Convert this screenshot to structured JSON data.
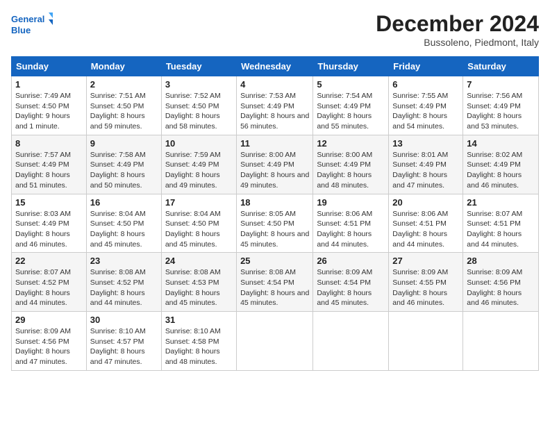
{
  "header": {
    "logo_line1": "General",
    "logo_line2": "Blue",
    "month_title": "December 2024",
    "location": "Bussoleno, Piedmont, Italy"
  },
  "days_of_week": [
    "Sunday",
    "Monday",
    "Tuesday",
    "Wednesday",
    "Thursday",
    "Friday",
    "Saturday"
  ],
  "weeks": [
    [
      {
        "day": 1,
        "info": "Sunrise: 7:49 AM\nSunset: 4:50 PM\nDaylight: 9 hours and 1 minute."
      },
      {
        "day": 2,
        "info": "Sunrise: 7:51 AM\nSunset: 4:50 PM\nDaylight: 8 hours and 59 minutes."
      },
      {
        "day": 3,
        "info": "Sunrise: 7:52 AM\nSunset: 4:50 PM\nDaylight: 8 hours and 58 minutes."
      },
      {
        "day": 4,
        "info": "Sunrise: 7:53 AM\nSunset: 4:49 PM\nDaylight: 8 hours and 56 minutes."
      },
      {
        "day": 5,
        "info": "Sunrise: 7:54 AM\nSunset: 4:49 PM\nDaylight: 8 hours and 55 minutes."
      },
      {
        "day": 6,
        "info": "Sunrise: 7:55 AM\nSunset: 4:49 PM\nDaylight: 8 hours and 54 minutes."
      },
      {
        "day": 7,
        "info": "Sunrise: 7:56 AM\nSunset: 4:49 PM\nDaylight: 8 hours and 53 minutes."
      }
    ],
    [
      {
        "day": 8,
        "info": "Sunrise: 7:57 AM\nSunset: 4:49 PM\nDaylight: 8 hours and 51 minutes."
      },
      {
        "day": 9,
        "info": "Sunrise: 7:58 AM\nSunset: 4:49 PM\nDaylight: 8 hours and 50 minutes."
      },
      {
        "day": 10,
        "info": "Sunrise: 7:59 AM\nSunset: 4:49 PM\nDaylight: 8 hours and 49 minutes."
      },
      {
        "day": 11,
        "info": "Sunrise: 8:00 AM\nSunset: 4:49 PM\nDaylight: 8 hours and 49 minutes."
      },
      {
        "day": 12,
        "info": "Sunrise: 8:00 AM\nSunset: 4:49 PM\nDaylight: 8 hours and 48 minutes."
      },
      {
        "day": 13,
        "info": "Sunrise: 8:01 AM\nSunset: 4:49 PM\nDaylight: 8 hours and 47 minutes."
      },
      {
        "day": 14,
        "info": "Sunrise: 8:02 AM\nSunset: 4:49 PM\nDaylight: 8 hours and 46 minutes."
      }
    ],
    [
      {
        "day": 15,
        "info": "Sunrise: 8:03 AM\nSunset: 4:49 PM\nDaylight: 8 hours and 46 minutes."
      },
      {
        "day": 16,
        "info": "Sunrise: 8:04 AM\nSunset: 4:50 PM\nDaylight: 8 hours and 45 minutes."
      },
      {
        "day": 17,
        "info": "Sunrise: 8:04 AM\nSunset: 4:50 PM\nDaylight: 8 hours and 45 minutes."
      },
      {
        "day": 18,
        "info": "Sunrise: 8:05 AM\nSunset: 4:50 PM\nDaylight: 8 hours and 45 minutes."
      },
      {
        "day": 19,
        "info": "Sunrise: 8:06 AM\nSunset: 4:51 PM\nDaylight: 8 hours and 44 minutes."
      },
      {
        "day": 20,
        "info": "Sunrise: 8:06 AM\nSunset: 4:51 PM\nDaylight: 8 hours and 44 minutes."
      },
      {
        "day": 21,
        "info": "Sunrise: 8:07 AM\nSunset: 4:51 PM\nDaylight: 8 hours and 44 minutes."
      }
    ],
    [
      {
        "day": 22,
        "info": "Sunrise: 8:07 AM\nSunset: 4:52 PM\nDaylight: 8 hours and 44 minutes."
      },
      {
        "day": 23,
        "info": "Sunrise: 8:08 AM\nSunset: 4:52 PM\nDaylight: 8 hours and 44 minutes."
      },
      {
        "day": 24,
        "info": "Sunrise: 8:08 AM\nSunset: 4:53 PM\nDaylight: 8 hours and 45 minutes."
      },
      {
        "day": 25,
        "info": "Sunrise: 8:08 AM\nSunset: 4:54 PM\nDaylight: 8 hours and 45 minutes."
      },
      {
        "day": 26,
        "info": "Sunrise: 8:09 AM\nSunset: 4:54 PM\nDaylight: 8 hours and 45 minutes."
      },
      {
        "day": 27,
        "info": "Sunrise: 8:09 AM\nSunset: 4:55 PM\nDaylight: 8 hours and 46 minutes."
      },
      {
        "day": 28,
        "info": "Sunrise: 8:09 AM\nSunset: 4:56 PM\nDaylight: 8 hours and 46 minutes."
      }
    ],
    [
      {
        "day": 29,
        "info": "Sunrise: 8:09 AM\nSunset: 4:56 PM\nDaylight: 8 hours and 47 minutes."
      },
      {
        "day": 30,
        "info": "Sunrise: 8:10 AM\nSunset: 4:57 PM\nDaylight: 8 hours and 47 minutes."
      },
      {
        "day": 31,
        "info": "Sunrise: 8:10 AM\nSunset: 4:58 PM\nDaylight: 8 hours and 48 minutes."
      },
      null,
      null,
      null,
      null
    ]
  ]
}
